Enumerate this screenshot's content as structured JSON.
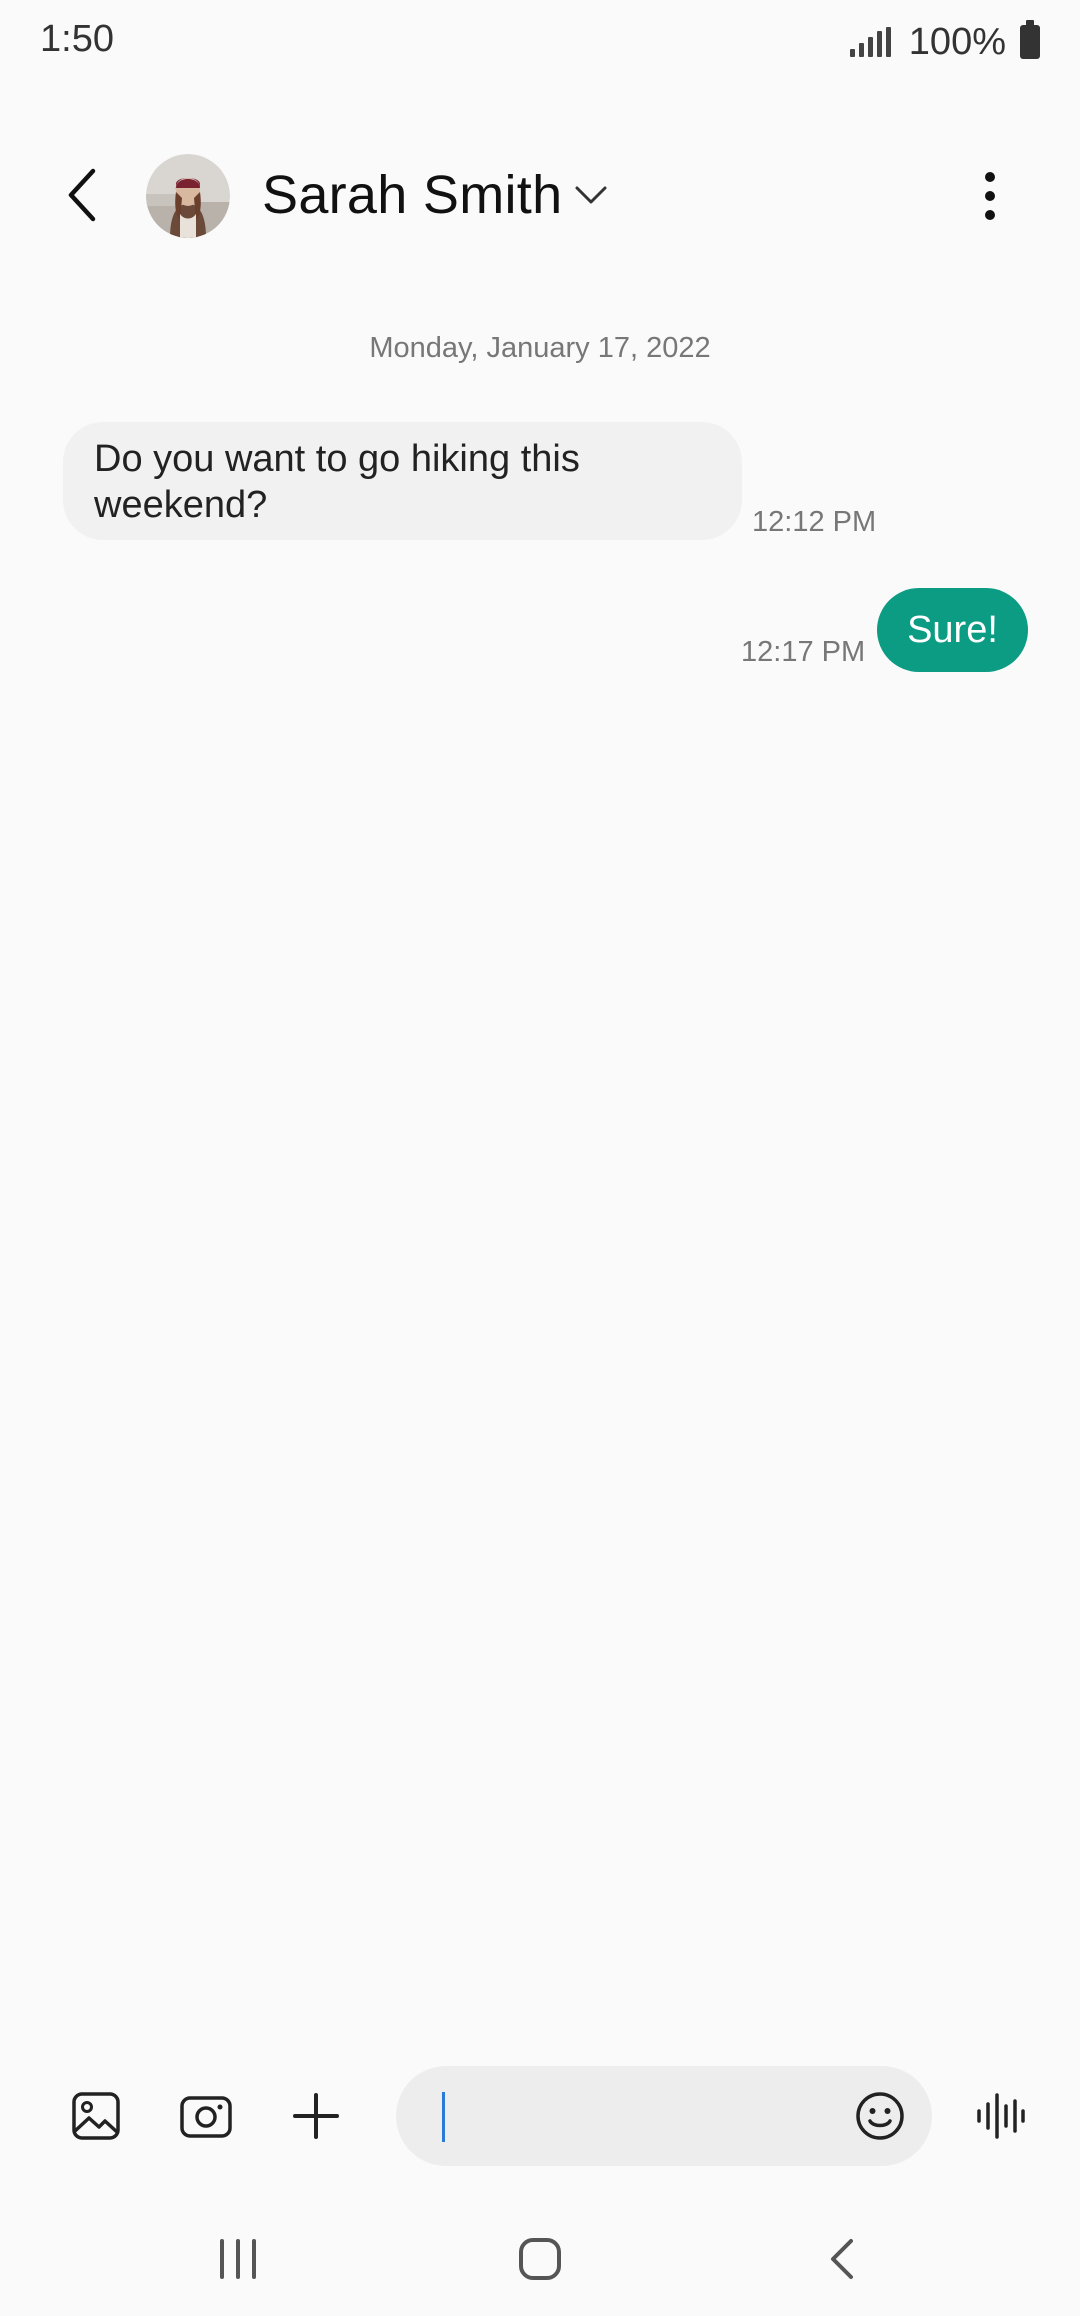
{
  "status_bar": {
    "time": "1:50",
    "battery_percent": "100%",
    "icons": [
      "signal-icon",
      "battery-icon"
    ]
  },
  "header": {
    "contact_name": "Sarah Smith",
    "icons": [
      "back-arrow-icon",
      "chevron-down-icon",
      "more-vertical-icon"
    ]
  },
  "conversation": {
    "date": "Monday, January 17, 2022",
    "messages": [
      {
        "direction": "incoming",
        "text": "Do you want to go hiking this weekend?",
        "time": "12:12 PM"
      },
      {
        "direction": "outgoing",
        "text": "Sure!",
        "time": "12:17 PM"
      }
    ]
  },
  "composer": {
    "input_value": "",
    "input_placeholder": "",
    "icons": [
      "gallery-icon",
      "camera-icon",
      "plus-icon",
      "emoji-icon",
      "voice-recorder-icon"
    ]
  },
  "nav_bar": {
    "icons": [
      "recent-apps-icon",
      "home-icon",
      "back-icon"
    ]
  },
  "colors": {
    "background": "#fafafa",
    "outgoing_bubble": "#0c9c83",
    "incoming_bubble": "#f1f1f1",
    "cursor": "#2a7ad8"
  }
}
